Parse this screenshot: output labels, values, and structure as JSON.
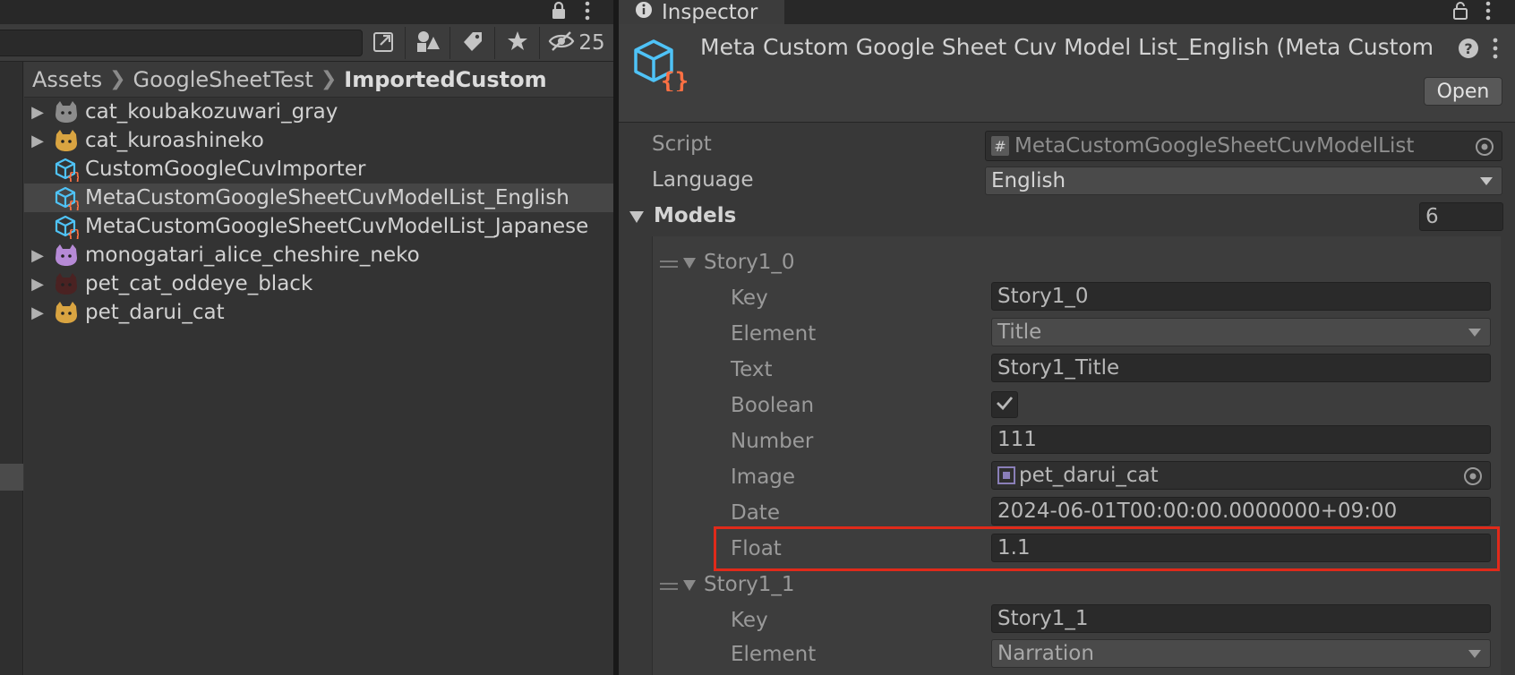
{
  "project": {
    "filter_count": "25",
    "breadcrumb": [
      "Assets",
      "GoogleSheetTest",
      "ImportedCustom"
    ],
    "files": [
      {
        "name": "cat_koubakozuwari_gray",
        "icon": "gray-cat-sprite-icon",
        "expandable": true,
        "selected": false,
        "color": "#8c8c8c"
      },
      {
        "name": "cat_kuroashineko",
        "icon": "orange-cat-sprite-icon",
        "expandable": true,
        "selected": false,
        "color": "#d9a441"
      },
      {
        "name": "CustomGoogleCuvImporter",
        "icon": "script-asset-icon",
        "expandable": false,
        "selected": false
      },
      {
        "name": "MetaCustomGoogleSheetCuvModelList_English",
        "icon": "script-asset-icon",
        "expandable": false,
        "selected": true
      },
      {
        "name": "MetaCustomGoogleSheetCuvModelList_Japanese",
        "icon": "script-asset-icon",
        "expandable": false,
        "selected": false
      },
      {
        "name": "monogatari_alice_cheshire_neko",
        "icon": "purple-cat-sprite-icon",
        "expandable": true,
        "selected": false,
        "color": "#b68ad6"
      },
      {
        "name": "pet_cat_oddeye_black",
        "icon": "black-cat-sprite-icon",
        "expandable": true,
        "selected": false,
        "color": "#4a2222"
      },
      {
        "name": "pet_darui_cat",
        "icon": "lazy-cat-sprite-icon",
        "expandable": true,
        "selected": false,
        "color": "#d9a441"
      }
    ]
  },
  "inspector": {
    "tab_label": "Inspector",
    "title": "Meta Custom Google Sheet Cuv Model List_English (Meta Custom",
    "open_label": "Open",
    "script_label": "Script",
    "script_value": "MetaCustomGoogleSheetCuvModelList",
    "language_label": "Language",
    "language_value": "English",
    "models_label": "Models",
    "models_count": "6",
    "story0": {
      "name": "Story1_0",
      "key_label": "Key",
      "key_value": "Story1_0",
      "element_label": "Element",
      "element_value": "Title",
      "text_label": "Text",
      "text_value": "Story1_Title",
      "boolean_label": "Boolean",
      "boolean_value": true,
      "number_label": "Number",
      "number_value": "111",
      "image_label": "Image",
      "image_value": "pet_darui_cat",
      "date_label": "Date",
      "date_value": "2024-06-01T00:00:00.0000000+09:00",
      "float_label": "Float",
      "float_value": "1.1"
    },
    "story1": {
      "name": "Story1_1",
      "key_label": "Key",
      "key_value": "Story1_1",
      "element_label": "Element",
      "element_value": "Narration"
    },
    "accent_script_icon": "#4fc3f7",
    "accent_brace": "#ff7043",
    "highlight_color": "#e02a1a"
  }
}
